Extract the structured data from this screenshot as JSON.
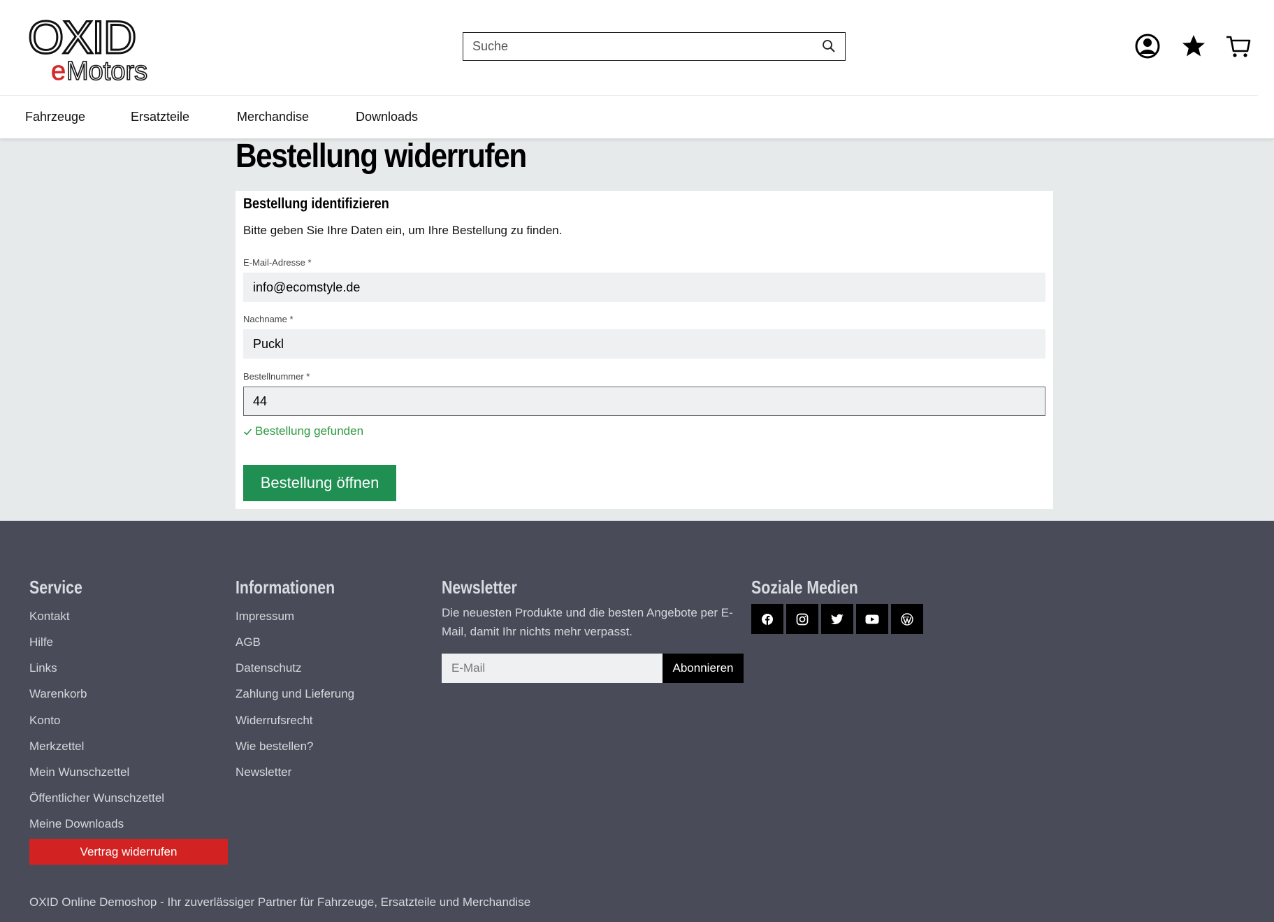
{
  "header": {
    "logo_text_main": "OXID",
    "logo_text_sub_e": "e",
    "logo_text_sub": "Motors",
    "search_placeholder": "Suche"
  },
  "nav": {
    "items": [
      {
        "label": "Fahrzeuge"
      },
      {
        "label": "Ersatzteile"
      },
      {
        "label": "Merchandise"
      },
      {
        "label": "Downloads"
      }
    ]
  },
  "main": {
    "title": "Bestellung widerrufen",
    "card_title": "Bestellung identifizieren",
    "card_desc": "Bitte geben Sie Ihre Daten ein, um Ihre Bestellung zu finden.",
    "email_label": "E-Mail-Adresse *",
    "email_value": "info@ecomstyle.de",
    "lastname_label": "Nachname *",
    "lastname_value": "Puckl",
    "ordernr_label": "Bestellnummer *",
    "ordernr_value": "44",
    "status_text": "Bestellung gefunden",
    "open_button": "Bestellung öffnen"
  },
  "colors": {
    "accent_green": "#1f8f52",
    "success_text": "#2e9a43",
    "revoke_red": "#d32222",
    "footer_bg": "#494c58",
    "page_bg": "#e7eaea"
  },
  "footer": {
    "service": {
      "heading": "Service",
      "links": [
        "Kontakt",
        "Hilfe",
        "Links",
        "Warenkorb",
        "Konto",
        "Merkzettel",
        "Mein Wunschzettel",
        "Öffentlicher Wunschzettel",
        "Meine Downloads"
      ],
      "revoke_button": "Vertrag widerrufen"
    },
    "info": {
      "heading": "Informationen",
      "links": [
        "Impressum",
        "AGB",
        "Datenschutz",
        "Zahlung und Lieferung",
        "Widerrufsrecht",
        "Wie bestellen?",
        "Newsletter"
      ]
    },
    "newsletter": {
      "heading": "Newsletter",
      "text": "Die neuesten Produkte und die besten Angebote per E-Mail, damit Ihr nichts mehr verpasst.",
      "placeholder": "E-Mail",
      "button": "Abonnieren"
    },
    "social": {
      "heading": "Soziale Medien",
      "icons": [
        "facebook-icon",
        "instagram-icon",
        "twitter-icon",
        "youtube-icon",
        "wordpress-icon"
      ]
    },
    "bottom_text": "OXID Online Demoshop - Ihr zuverlässiger Partner für Fahrzeuge, Ersatzteile und Merchandise"
  }
}
